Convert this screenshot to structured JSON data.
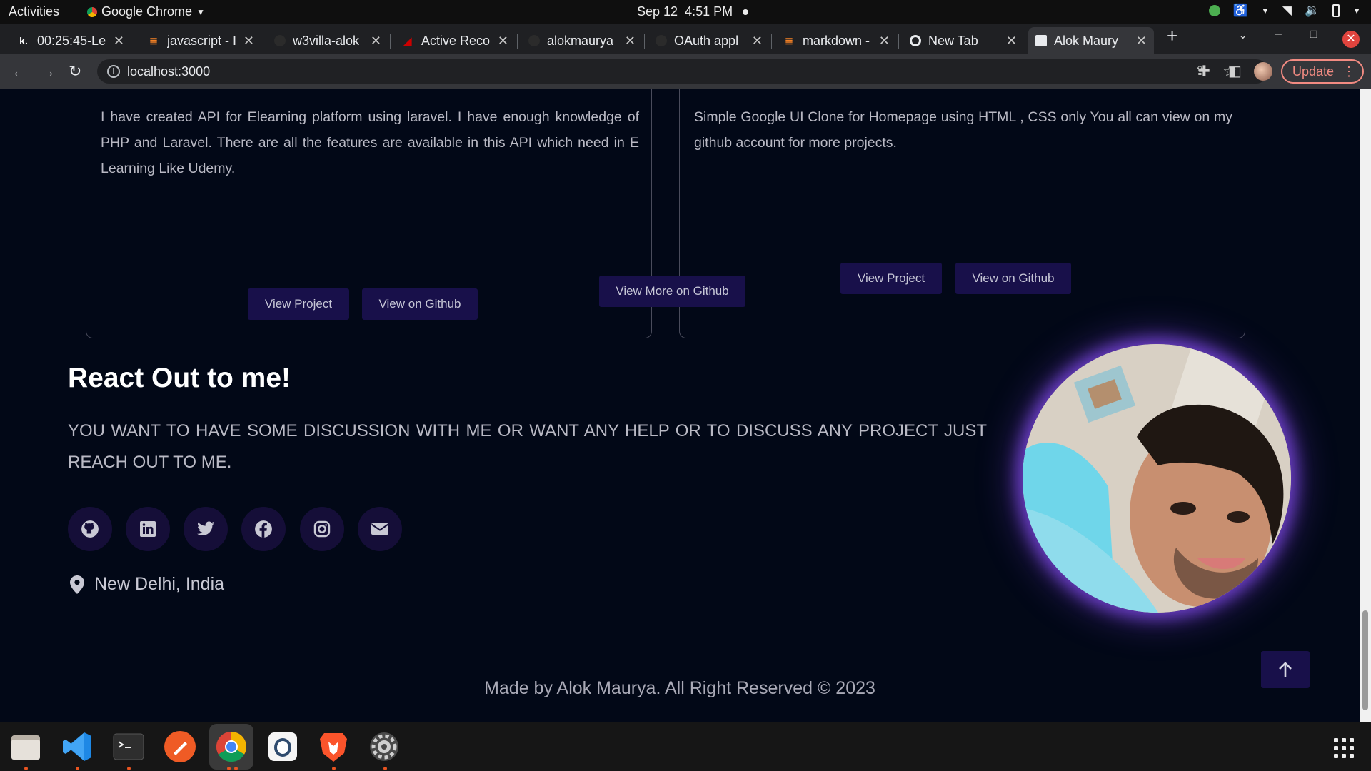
{
  "topbar": {
    "activities": "Activities",
    "app_name": "Google Chrome",
    "date": "Sep 12",
    "time": "4:51 PM"
  },
  "tabs": [
    {
      "label": "00:25:45-Le",
      "favicon": "k."
    },
    {
      "label": "javascript - I",
      "favicon": "stackoverflow-icon"
    },
    {
      "label": "w3villa-alok",
      "favicon": "github-icon"
    },
    {
      "label": "Active Reco",
      "favicon": "rails-icon"
    },
    {
      "label": "alokmaurya",
      "favicon": "github-icon"
    },
    {
      "label": "OAuth appl",
      "favicon": "github-icon"
    },
    {
      "label": "markdown -",
      "favicon": "stackoverflow-icon"
    },
    {
      "label": "New Tab",
      "favicon": "chrome-icon"
    },
    {
      "label": "Alok Maury",
      "favicon": "page-icon"
    }
  ],
  "address_bar": {
    "url": "localhost:3000",
    "update_label": "Update"
  },
  "projects": [
    {
      "description": "I have created API for Elearning platform using laravel. I have enough knowledge of PHP and Laravel. There are all the features are available in this API which need in E Learning Like Udemy.",
      "view_project": "View Project",
      "view_github": "View on Github"
    },
    {
      "description": "Simple Google UI Clone for Homepage using HTML , CSS only You all can view on my github account for more projects.",
      "view_project": "View Project",
      "view_github": "View on Github"
    }
  ],
  "view_more": "View More on Github",
  "contact": {
    "heading": "React Out to me!",
    "text": "You want to have some discussion with me or want any help or to discuss any project just reach out to me.",
    "location": "New Delhi, India",
    "socials": [
      "github-icon",
      "linkedin-icon",
      "twitter-icon",
      "facebook-icon",
      "instagram-icon",
      "envelope-icon"
    ]
  },
  "footer": "Made by Alok Maurya. All Right Reserved © 2023",
  "colors": {
    "page_bg": "#020817",
    "button_bg": "#18104a",
    "glow": "#6a3ec4"
  }
}
